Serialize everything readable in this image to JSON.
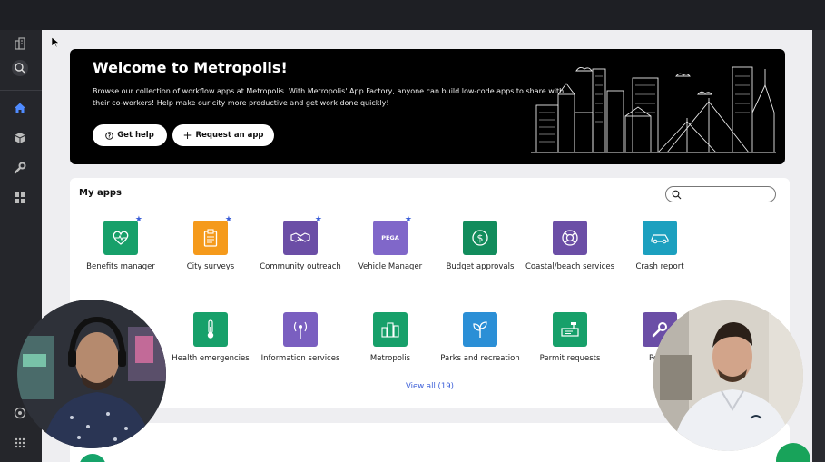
{
  "sidebar": {
    "items": [
      {
        "icon": "building-icon"
      },
      {
        "icon": "search-icon"
      },
      {
        "icon": "home-icon",
        "active": true
      },
      {
        "icon": "cube-icon"
      },
      {
        "icon": "wrench-icon"
      },
      {
        "icon": "grid-icon"
      },
      {
        "icon": "help-icon"
      },
      {
        "icon": "apps-icon"
      }
    ]
  },
  "hero": {
    "title": "Welcome to Metropolis!",
    "description": "Browse our collection of workflow apps at Metropolis. With Metropolis' App Factory, anyone can build low-code apps to share with their co-workers! Help make our city more productive and get work done quickly!",
    "help_button": "Get help",
    "request_button": "Request an app"
  },
  "my_apps": {
    "title": "My apps",
    "search_placeholder": "",
    "view_all": "View all (19)",
    "apps": [
      {
        "label": "Benefits manager",
        "icon": "heart-icon",
        "color": "#17a06a",
        "starred": true
      },
      {
        "label": "City surveys",
        "icon": "clipboard-icon",
        "color": "#f59a1b",
        "starred": true
      },
      {
        "label": "Community outreach",
        "icon": "handshake-icon",
        "color": "#6b4ea6",
        "starred": true
      },
      {
        "label": "Vehicle Manager",
        "icon": "pega-icon",
        "icon_text": "PEGA",
        "color": "#8067c9",
        "starred": true
      },
      {
        "label": "Budget approvals",
        "icon": "dollar-icon",
        "color": "#128c5c",
        "starred": false
      },
      {
        "label": "Coastal/beach services",
        "icon": "lifebuoy-icon",
        "color": "#6b4ea6",
        "starred": false
      },
      {
        "label": "Crash report",
        "icon": "car-icon",
        "color": "#1ca0bf",
        "starred": false
      },
      {
        "label": "Health emergencies",
        "icon": "thermometer-icon",
        "color": "#17a06a",
        "starred": false
      },
      {
        "label": "Information services",
        "icon": "antenna-icon",
        "color": "#7a5fc0",
        "starred": false
      },
      {
        "label": "Metropolis",
        "icon": "city-icon",
        "color": "#17a06a",
        "starred": false
      },
      {
        "label": "Parks and recreation",
        "icon": "sprout-icon",
        "color": "#2b8fd6",
        "starred": false
      },
      {
        "label": "Permit requests",
        "icon": "permit-icon",
        "color": "#17a06a",
        "starred": false
      },
      {
        "label": "Potho",
        "icon": "wrench-icon",
        "color": "#6b4ea6",
        "starred": false
      }
    ]
  },
  "colors": {
    "accent": "#3c5fd8",
    "sidebar_bg": "#25262b",
    "hero_bg": "#000000"
  }
}
